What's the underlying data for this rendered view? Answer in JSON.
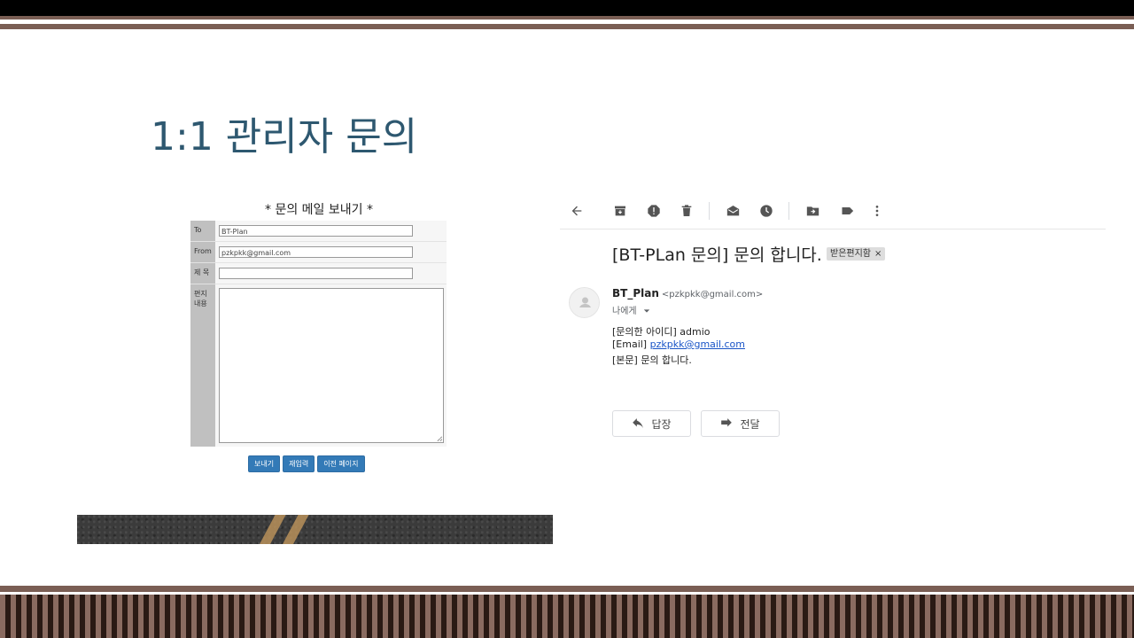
{
  "slide": {
    "title": "1:1 관리자 문의"
  },
  "form": {
    "title": "* 문의 메일 보내기 *",
    "fields": {
      "to_label": "To",
      "to_value": "BT-Plan",
      "from_label": "From",
      "from_value": "pzkpkk@gmail.com",
      "subject_label": "제 목",
      "subject_value": "",
      "content_label": "편지 내용"
    },
    "buttons": {
      "send": "보내기",
      "reset": "재입력",
      "prev": "이전 페이지"
    }
  },
  "mail": {
    "subject": "[BT-PLan 문의] 문의 합니다.",
    "label_badge": "받은편지함",
    "label_close": "×",
    "sender_name": "BT_Plan",
    "sender_email": "<pzkpkk@gmail.com>",
    "to_me": "나에게",
    "body": {
      "line1": "[문의한 아이디] admio",
      "line2_prefix": "[Email] ",
      "line2_link": "pzkpkk@gmail.com",
      "line3": " [본문] 문의 합니다."
    },
    "reply_label": "답장",
    "forward_label": "전달"
  },
  "icons": {
    "back": "arrow-left-icon",
    "archive": "archive-icon",
    "spam": "report-spam-icon",
    "delete": "trash-icon",
    "unread": "mark-unread-icon",
    "snooze": "clock-icon",
    "move": "move-to-icon",
    "label": "label-icon",
    "more": "more-vert-icon"
  },
  "colors": {
    "title": "#2e5870",
    "button_blue": "#337ab7",
    "link": "#1a55c7",
    "deco_brown": "#7a5e54"
  }
}
